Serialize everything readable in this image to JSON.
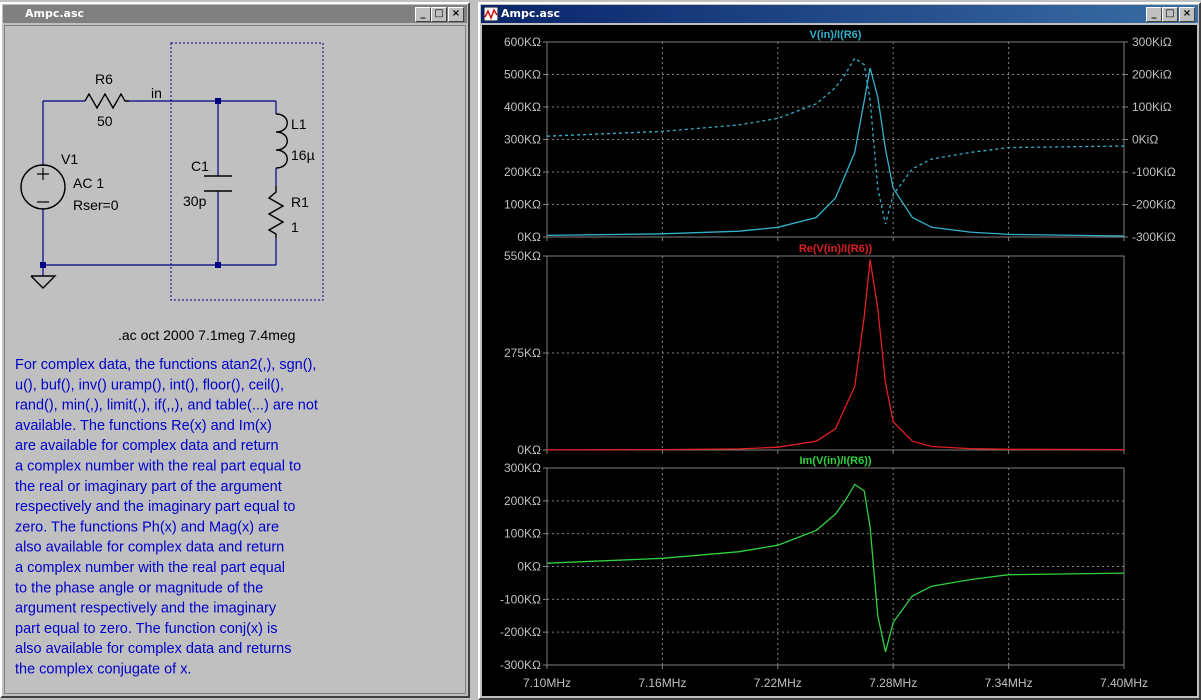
{
  "schematic_window": {
    "title": "Ampc.asc",
    "buttons": {
      "minimize": "_",
      "maximize": "□",
      "close": "×"
    },
    "components": {
      "r6_name": "R6",
      "r6_value": "50",
      "net_in": "in",
      "v1_name": "V1",
      "v1_value": "AC 1",
      "v1_rser": "Rser=0",
      "c1_name": "C1",
      "c1_value": "30p",
      "l1_name": "L1",
      "l1_value": "16µ",
      "r1_name": "R1",
      "r1_value": "1"
    },
    "directive": ".ac oct 2000 7.1meg 7.4meg",
    "comment_lines": [
      "For complex data, the functions atan2(,), sgn(),",
      "u(), buf(), inv() uramp(), int(), floor(), ceil(),",
      "rand(), min(,), limit(,), if(,,), and table(...) are not",
      "available. The functions Re(x) and Im(x)",
      "are available for complex data and return",
      "a complex number with the real part equal to",
      "the real or imaginary part of the argument",
      "respectively and the imaginary part equal to",
      "zero. The functions Ph(x) and Mag(x) are",
      "also available for complex data and return",
      "a complex number with the real part equal",
      "to the phase angle or magnitude of the",
      "argument respectively and the imaginary",
      "part equal to zero. The function conj(x) is",
      "also available for complex data and returns",
      "the complex conjugate of x."
    ]
  },
  "waveform_window": {
    "title": "Ampc.asc",
    "buttons": {
      "minimize": "_",
      "maximize": "□",
      "close": "×"
    }
  },
  "chart_data": [
    {
      "type": "line",
      "title": "V(in)/I(R6)",
      "color": "#33b0c8",
      "x_ticks": [
        "7.10MHz",
        "7.16MHz",
        "7.22MHz",
        "7.28MHz",
        "7.34MHz",
        "7.40MHz"
      ],
      "y_ticks": [
        "600KΩ",
        "500KΩ",
        "400KΩ",
        "300KΩ",
        "200KΩ",
        "100KΩ",
        "0KΩ"
      ],
      "y2_ticks": [
        "300KiΩ",
        "200KiΩ",
        "100KiΩ",
        "0KiΩ",
        "-100KiΩ",
        "-200KiΩ",
        "-300KiΩ"
      ],
      "ylim": [
        0,
        600
      ],
      "y2lim": [
        -300,
        300
      ],
      "series": [
        {
          "role": "magnitude",
          "style": "solid",
          "x": [
            7.1,
            7.16,
            7.2,
            7.22,
            7.24,
            7.25,
            7.26,
            7.265,
            7.268,
            7.272,
            7.276,
            7.28,
            7.29,
            7.3,
            7.32,
            7.34,
            7.4
          ],
          "values": [
            5,
            10,
            18,
            30,
            60,
            120,
            260,
            420,
            520,
            430,
            270,
            150,
            60,
            30,
            15,
            8,
            3
          ]
        },
        {
          "role": "phase",
          "style": "dashed",
          "x": [
            7.1,
            7.16,
            7.2,
            7.22,
            7.24,
            7.25,
            7.255,
            7.26,
            7.265,
            7.268,
            7.272,
            7.276,
            7.28,
            7.29,
            7.3,
            7.32,
            7.34,
            7.4
          ],
          "values": [
            10,
            25,
            45,
            65,
            110,
            160,
            200,
            250,
            230,
            120,
            -150,
            -260,
            -170,
            -90,
            -60,
            -40,
            -25,
            -20
          ]
        }
      ]
    },
    {
      "type": "line",
      "title": "Re(V(in)/I(R6))",
      "color": "#e02020",
      "x_ticks": [
        "7.10MHz",
        "7.16MHz",
        "7.22MHz",
        "7.28MHz",
        "7.34MHz",
        "7.40MHz"
      ],
      "y_ticks": [
        "550KΩ",
        "275KΩ",
        "0KΩ"
      ],
      "ylim": [
        0,
        550
      ],
      "series": [
        {
          "role": "real",
          "style": "solid",
          "x": [
            7.1,
            7.16,
            7.2,
            7.22,
            7.24,
            7.25,
            7.26,
            7.265,
            7.268,
            7.272,
            7.276,
            7.28,
            7.29,
            7.3,
            7.32,
            7.34,
            7.4
          ],
          "values": [
            0.5,
            1,
            3,
            8,
            25,
            60,
            180,
            380,
            540,
            400,
            190,
            80,
            25,
            10,
            4,
            2,
            1
          ]
        }
      ]
    },
    {
      "type": "line",
      "title": "Im(V(in)/I(R6))",
      "color": "#30d040",
      "x_ticks": [
        "7.10MHz",
        "7.16MHz",
        "7.22MHz",
        "7.28MHz",
        "7.34MHz",
        "7.40MHz"
      ],
      "y_ticks": [
        "300KΩ",
        "200KΩ",
        "100KΩ",
        "0KΩ",
        "-100KΩ",
        "-200KΩ",
        "-300KΩ"
      ],
      "ylim": [
        -300,
        300
      ],
      "series": [
        {
          "role": "imaginary",
          "style": "solid",
          "x": [
            7.1,
            7.16,
            7.2,
            7.22,
            7.24,
            7.25,
            7.255,
            7.26,
            7.265,
            7.268,
            7.272,
            7.276,
            7.28,
            7.29,
            7.3,
            7.32,
            7.34,
            7.4
          ],
          "values": [
            10,
            25,
            45,
            65,
            110,
            160,
            200,
            250,
            230,
            120,
            -150,
            -260,
            -170,
            -90,
            -60,
            -40,
            -25,
            -20
          ]
        }
      ]
    }
  ]
}
